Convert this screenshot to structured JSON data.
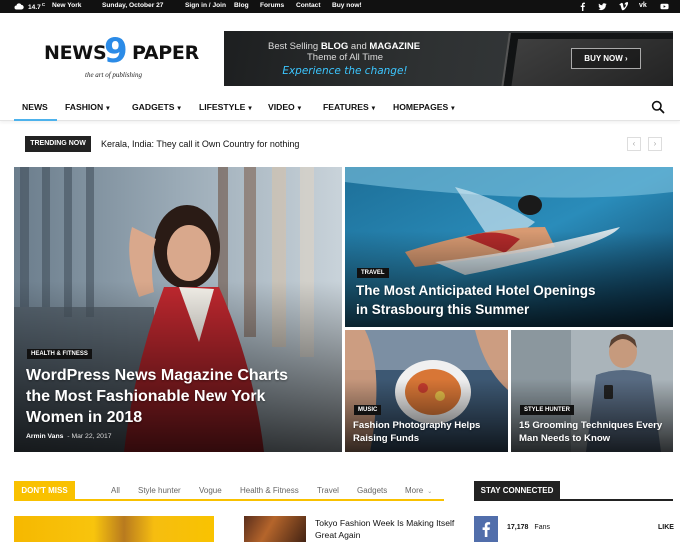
{
  "topbar": {
    "weather_temp": "14.7",
    "weather_unit": "C",
    "city": "New York",
    "date": "Sunday, October 27",
    "links": [
      "Sign in / Join",
      "Blog",
      "Forums",
      "Contact",
      "Buy now!"
    ],
    "social_icons": [
      "facebook-icon",
      "twitter-icon",
      "vimeo-icon",
      "vk-icon",
      "youtube-icon"
    ]
  },
  "header": {
    "logo_left": "NEWS",
    "logo_nine": "9",
    "logo_right": "PAPER",
    "tagline": "the art of publishing",
    "banner": {
      "line1_pre": "Best Selling ",
      "line1_bold": "BLOG",
      "line1_mid": " and ",
      "line1_bold2": "MAGAZINE",
      "line2": "Theme of All Time",
      "line3": "Experience the change!",
      "button": "BUY NOW ›"
    }
  },
  "nav": {
    "items": [
      {
        "label": "NEWS",
        "dropdown": false
      },
      {
        "label": "FASHION",
        "dropdown": true
      },
      {
        "label": "GADGETS",
        "dropdown": true
      },
      {
        "label": "LIFESTYLE",
        "dropdown": true
      },
      {
        "label": "VIDEO",
        "dropdown": true
      },
      {
        "label": "FEATURES",
        "dropdown": true
      },
      {
        "label": "HOMEPAGES",
        "dropdown": true
      }
    ],
    "chevron": "⌄",
    "search_icon": "search-icon"
  },
  "trending": {
    "badge": "TRENDING NOW",
    "headline": "Kerala, India: They call it Own Country for nothing",
    "prev": "‹",
    "next": "›"
  },
  "featured": {
    "main": {
      "category": "HEALTH & FITNESS",
      "title_lines": [
        "WordPress News Magazine Charts",
        "the Most Fashionable New York",
        "Women in 2018"
      ],
      "author": "Armin Vans",
      "date": "Mar 22, 2017"
    },
    "top_right": {
      "category": "TRAVEL",
      "title_lines": [
        "The Most Anticipated Hotel Openings",
        "in Strasbourg this Summer"
      ]
    },
    "bottom_mid": {
      "category": "MUSIC",
      "title_lines": [
        "Fashion Photography Helps",
        "Raising Funds"
      ]
    },
    "bottom_right": {
      "category": "STYLE HUNTER",
      "title_lines": [
        "15 Grooming Techniques Every",
        "Man Needs to Know"
      ]
    }
  },
  "dont_miss": {
    "badge": "DON'T MISS",
    "tabs": [
      "All",
      "Style hunter",
      "Vogue",
      "Health & Fitness",
      "Travel",
      "Gadgets",
      "More"
    ],
    "article_title": "Tokyo Fashion Week Is Making Itself Great Again"
  },
  "stay_connected": {
    "badge": "STAY CONNECTED",
    "fb_count": "17,178",
    "fb_unit": "Fans",
    "fb_action": "LIKE"
  },
  "colors": {
    "accent_blue": "#4db2ec",
    "logo_blue": "#2b8be7",
    "dont_miss_yellow": "#f9c100",
    "facebook_blue": "#516eab"
  }
}
